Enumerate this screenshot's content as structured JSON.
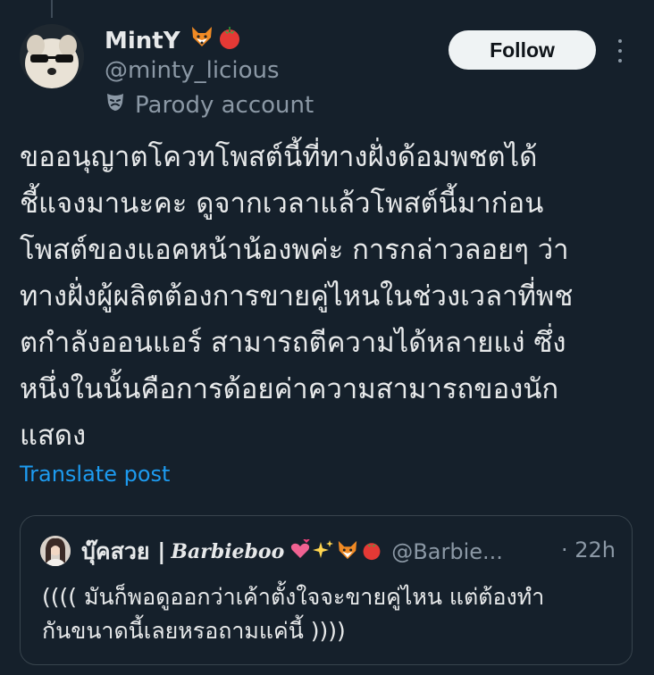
{
  "author": {
    "display_name": "MintY",
    "name_emojis": [
      "fox-emoji",
      "tomato-emoji"
    ],
    "handle": "@minty_licious",
    "account_label": "Parody account"
  },
  "actions": {
    "follow_label": "Follow",
    "more_icon": "more-vertical-icon"
  },
  "post": {
    "lines": [
      "ขออนุญาตโควทโพสต์นี้ที่ทางฝั่งด้อมพชตได้",
      "ชี้แจงมานะคะ ดูจากเวลาแล้วโพสต์นี้มาก่อน",
      "โพสต์ของแอคหน้าน้องพค่ะ การกล่าวลอยๆ ว่า",
      "ทางฝั่งผู้ผลิตต้องการขายคู่ไหนในช่วงเวลาที่พช",
      "ตกำลังออนแอร์ สามารถตีความได้หลายแง่ ซึ่ง",
      "หนึ่งในนั้นคือการด้อยค่าความสามารถของนัก",
      "แสดง"
    ],
    "translate_label": "Translate post"
  },
  "quote": {
    "display_name": "บุ๊คสวย |",
    "display_name_script": "Barbieboo",
    "name_emojis": [
      "two-hearts-emoji",
      "sparkles-emoji",
      "fox-emoji",
      "tomato-emoji"
    ],
    "handle": "@Barbie...",
    "time": "· 22h",
    "lines": [
      "(((( มันก็พอดูออกว่าเค้าตั้งใจจะขายคู่ไหน แต่ต้องทำ",
      "กันขนาดนี้เลยหรอถามแค่นี้ ))))"
    ]
  },
  "colors": {
    "background": "#15202b",
    "text": "#e7e9ea",
    "secondary": "#8b98a5",
    "link": "#1d9bf0",
    "button_bg": "#eff3f4"
  }
}
